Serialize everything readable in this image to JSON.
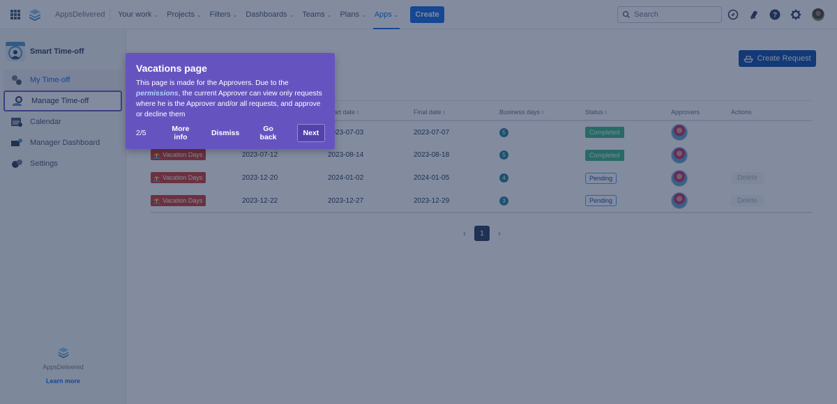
{
  "topnav": {
    "brand": "AppsDelivered",
    "items": [
      {
        "label": "Your work",
        "active": false
      },
      {
        "label": "Projects",
        "active": false
      },
      {
        "label": "Filters",
        "active": false
      },
      {
        "label": "Dashboards",
        "active": false
      },
      {
        "label": "Teams",
        "active": false
      },
      {
        "label": "Plans",
        "active": false
      },
      {
        "label": "Apps",
        "active": true
      }
    ],
    "create_label": "Create",
    "search_placeholder": "Search",
    "icons": [
      "compass-icon",
      "notification-bell-icon",
      "help-icon",
      "settings-gear-icon",
      "user-avatar"
    ]
  },
  "sidebar": {
    "app_title": "Smart Time-off",
    "items": [
      {
        "label": "My Time-off",
        "icon": "my-timeoff-icon",
        "state": "current"
      },
      {
        "label": "Manage Time-off",
        "icon": "manage-timeoff-icon",
        "state": "highlighted"
      },
      {
        "label": "Calendar",
        "icon": "calendar-icon",
        "state": ""
      },
      {
        "label": "Manager Dashboard",
        "icon": "dashboard-icon",
        "state": ""
      },
      {
        "label": "Settings",
        "icon": "settings-icon",
        "state": ""
      }
    ],
    "footer_brand": "AppsDelivered",
    "footer_link": "Learn more"
  },
  "main": {
    "create_request_label": "Create Request",
    "table": {
      "headers": [
        "",
        "",
        "Start date",
        "Final date",
        "Business days",
        "Status",
        "Approvers",
        "Actions"
      ],
      "sortable": [
        false,
        false,
        true,
        true,
        true,
        true,
        false,
        false
      ],
      "rows": [
        {
          "type": "",
          "request_date": "",
          "start_date": "2023-07-03",
          "final_date": "2023-07-07",
          "business_days": "5",
          "status": "Completed",
          "action": ""
        },
        {
          "type": "Vacation Days",
          "request_date": "2023-07-12",
          "start_date": "2023-08-14",
          "final_date": "2023-08-18",
          "business_days": "5",
          "status": "Completed",
          "action": ""
        },
        {
          "type": "Vacation Days",
          "request_date": "2023-12-20",
          "start_date": "2024-01-02",
          "final_date": "2024-01-05",
          "business_days": "4",
          "status": "Pending",
          "action": "Delete"
        },
        {
          "type": "Vacation Days",
          "request_date": "2023-12-22",
          "start_date": "2023-12-27",
          "final_date": "2023-12-29",
          "business_days": "3",
          "status": "Pending",
          "action": "Delete"
        }
      ]
    },
    "pagination": {
      "current_page": "1",
      "prev": "‹",
      "next": "›"
    }
  },
  "tour": {
    "title": "Vacations page",
    "text_before": "This page is made for the Approvers. Due to the ",
    "link": "permissions",
    "text_after": ", the current Approver can view only requests where he is the Approver and/or all requests, and approve or decline them",
    "step": "2/5",
    "more_info": "More info",
    "dismiss": "Dismiss",
    "go_back": "Go back",
    "next": "Next"
  },
  "colors": {
    "primary": "#0c66e4",
    "tour_bg": "#6554c0",
    "completed": "#36b37e",
    "vacation_badge": "#c9372c",
    "create_request": "#0747a6"
  }
}
